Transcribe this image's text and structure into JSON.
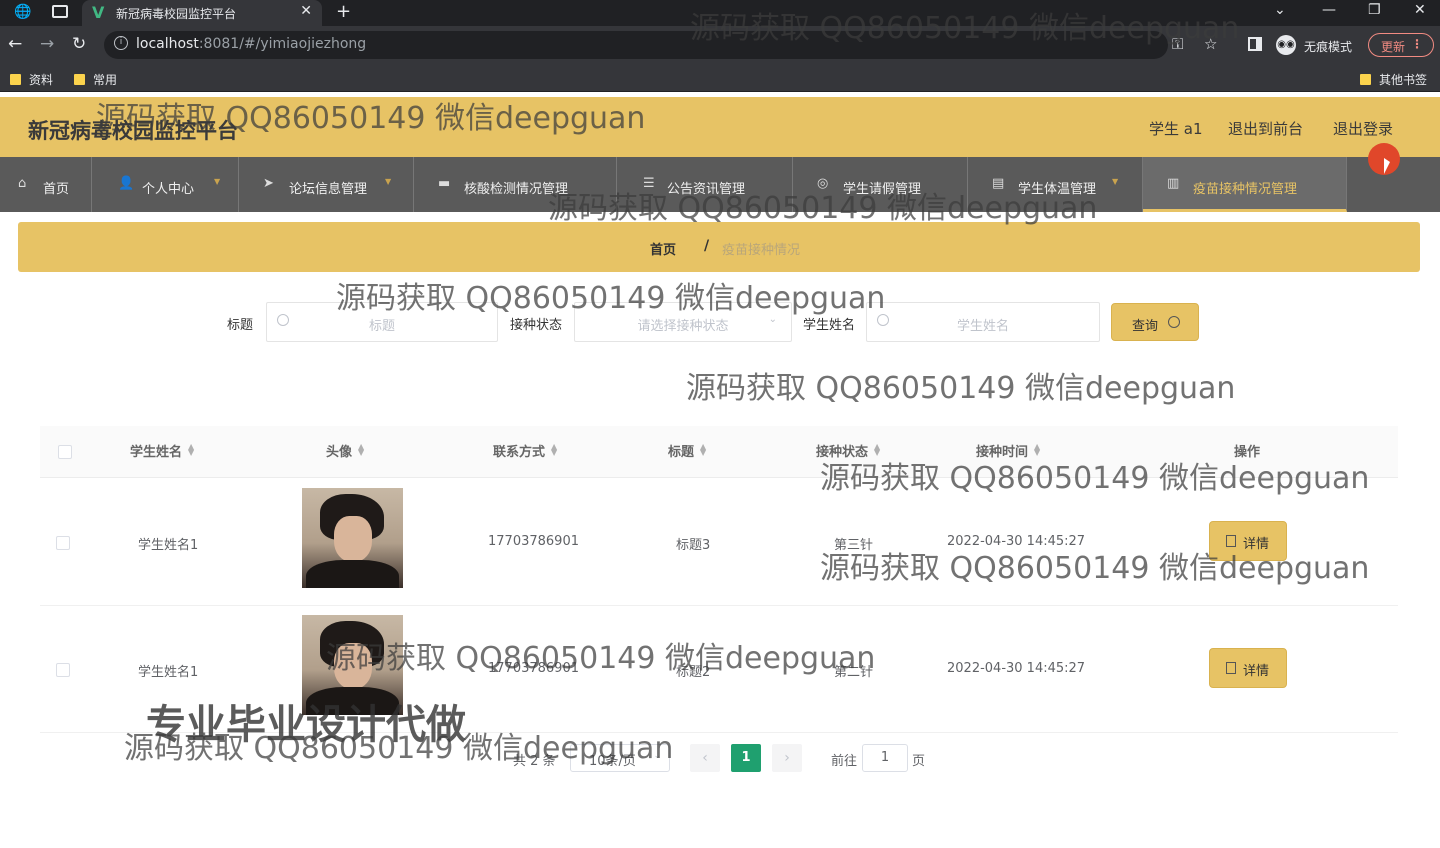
{
  "browser": {
    "tab_title": "新冠病毒校园监控平台",
    "url_host": "localhost",
    "url_rest": ":8081/#/yimiaojiezhong",
    "incognito_label": "无痕模式",
    "update_label": "更新",
    "bookmarks": [
      "资料",
      "常用"
    ],
    "other_bookmarks": "其他书签"
  },
  "header": {
    "title": "新冠病毒校园监控平台",
    "user": "学生 a1",
    "back_front": "退出到前台",
    "logout": "退出登录"
  },
  "menu": {
    "items": [
      {
        "label": "首页",
        "icon": "home-icon"
      },
      {
        "label": "个人中心",
        "icon": "user-icon"
      },
      {
        "label": "论坛信息管理",
        "icon": "send-icon"
      },
      {
        "label": "核酸检测情况管理",
        "icon": "monitor-icon"
      },
      {
        "label": "公告资讯管理",
        "icon": "list-icon"
      },
      {
        "label": "学生请假管理",
        "icon": "help-icon"
      },
      {
        "label": "学生体温管理",
        "icon": "doc-icon"
      },
      {
        "label": "疫苗接种情况管理",
        "icon": "chart-icon"
      }
    ]
  },
  "breadcrumb": {
    "home": "首页",
    "separator": "/",
    "current": "疫苗接种情况"
  },
  "search": {
    "title_label": "标题",
    "title_placeholder": "标题",
    "status_label": "接种状态",
    "status_placeholder": "请选择接种状态",
    "name_label": "学生姓名",
    "name_placeholder": "学生姓名",
    "query_label": "查询"
  },
  "table": {
    "columns": [
      "学生姓名",
      "头像",
      "联系方式",
      "标题",
      "接种状态",
      "接种时间",
      "操作"
    ],
    "rows": [
      {
        "name": "学生姓名1",
        "phone": "17703786901",
        "title": "标题3",
        "status": "第三针",
        "time": "2022-04-30 14:45:27",
        "action": "详情"
      },
      {
        "name": "学生姓名1",
        "phone": "17703786901",
        "title": "标题2",
        "status": "第二针",
        "time": "2022-04-30 14:45:27",
        "action": "详情"
      }
    ]
  },
  "pagination": {
    "total": "共 2 条",
    "page_size": "10条/页",
    "current_page": "1",
    "goto_label": "前往",
    "goto_value": "1",
    "page_unit": "页"
  },
  "watermarks": {
    "text": "源码获取 QQ86050149 微信deepguan",
    "ad": "专业毕业设计代做"
  },
  "colors": {
    "accent": "#e7c365",
    "menu_bg": "#5a5a5a",
    "page_active": "#1fa06f"
  }
}
